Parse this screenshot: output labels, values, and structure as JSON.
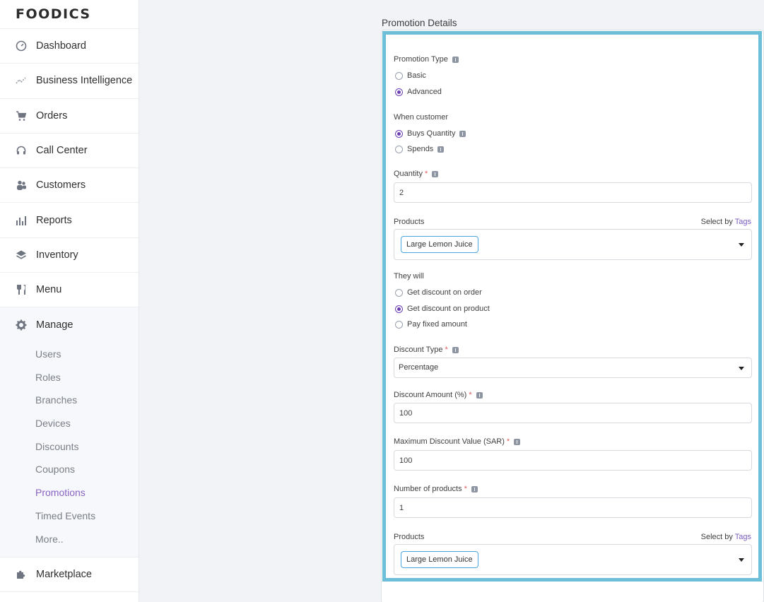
{
  "brand": "FOODICS",
  "sidebar": {
    "items": [
      {
        "label": "Dashboard",
        "icon": "dashboard-icon"
      },
      {
        "label": "Business Intelligence",
        "icon": "trend-icon"
      },
      {
        "label": "Orders",
        "icon": "cart-icon"
      },
      {
        "label": "Call Center",
        "icon": "headset-icon"
      },
      {
        "label": "Customers",
        "icon": "customers-icon"
      },
      {
        "label": "Reports",
        "icon": "bar-chart-icon"
      },
      {
        "label": "Inventory",
        "icon": "layers-icon"
      },
      {
        "label": "Menu",
        "icon": "cutlery-icon"
      }
    ],
    "manage": {
      "label": "Manage",
      "icon": "gear-icon",
      "sub_items": [
        "Users",
        "Roles",
        "Branches",
        "Devices",
        "Discounts",
        "Coupons",
        "Promotions",
        "Timed Events",
        "More.."
      ],
      "active": "Promotions"
    },
    "marketplace": {
      "label": "Marketplace",
      "icon": "puzzle-icon"
    }
  },
  "main": {
    "section_title": "Promotion Details",
    "form": {
      "promotion_type": {
        "label": "Promotion Type",
        "options": [
          "Basic",
          "Advanced"
        ],
        "selected": "Advanced"
      },
      "when_customer": {
        "label": "When customer",
        "options": [
          "Buys Quantity",
          "Spends"
        ],
        "selected": "Buys Quantity"
      },
      "quantity": {
        "label": "Quantity",
        "required_mark": "*",
        "value": "2"
      },
      "products_1": {
        "label": "Products",
        "select_by_text": "Select by",
        "select_by_link": "Tags",
        "tag": "Large Lemon Juice"
      },
      "they_will": {
        "label": "They will",
        "options": [
          "Get discount on order",
          "Get discount on product",
          "Pay fixed amount"
        ],
        "selected": "Get discount on product"
      },
      "discount_type": {
        "label": "Discount Type",
        "required_mark": "*",
        "value": "Percentage"
      },
      "discount_amount": {
        "label": "Discount Amount (%)",
        "required_mark": "*",
        "value": "100"
      },
      "max_discount": {
        "label": "Maximum Discount Value (SAR)",
        "required_mark": "*",
        "value": "100"
      },
      "number_of_products": {
        "label": "Number of products",
        "required_mark": "*",
        "value": "1"
      },
      "products_2": {
        "label": "Products",
        "select_by_text": "Select by",
        "select_by_link": "Tags",
        "tag": "Large Lemon Juice"
      }
    }
  },
  "colors": {
    "accent": "#6b40b4",
    "highlight_border": "#6dbfd9",
    "active_nav": "#8a63c4",
    "tag_border": "#4aa6e3"
  }
}
